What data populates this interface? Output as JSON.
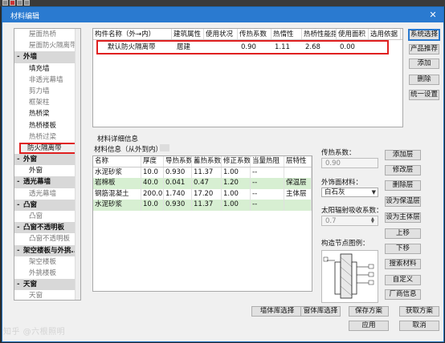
{
  "window": {
    "title": "材料编辑",
    "close_glyph": "✕"
  },
  "sidebar": {
    "items": [
      {
        "kind": "sub",
        "label": "屋面热桥"
      },
      {
        "kind": "sub",
        "label": "屋面防火隔离带"
      },
      {
        "kind": "cat",
        "toggle": "-",
        "label": "外墙"
      },
      {
        "kind": "sub-dark",
        "label": "填充墙"
      },
      {
        "kind": "sub",
        "label": "非透光幕墙"
      },
      {
        "kind": "sub",
        "label": "剪力墙"
      },
      {
        "kind": "sub",
        "label": "框架柱"
      },
      {
        "kind": "sub-dark",
        "label": "热桥梁"
      },
      {
        "kind": "sub-dark",
        "label": "热桥楼板"
      },
      {
        "kind": "sub",
        "label": "热桥过梁"
      },
      {
        "kind": "sub-sel",
        "label": "防火隔离带"
      },
      {
        "kind": "cat",
        "toggle": "-",
        "label": "外窗"
      },
      {
        "kind": "sub-dark",
        "label": "外窗"
      },
      {
        "kind": "cat",
        "toggle": "-",
        "label": "透光幕墙"
      },
      {
        "kind": "sub",
        "label": "透光幕墙"
      },
      {
        "kind": "cat",
        "toggle": "-",
        "label": "凸窗"
      },
      {
        "kind": "sub",
        "label": "凸窗"
      },
      {
        "kind": "cat",
        "toggle": "-",
        "label": "凸窗不透明板"
      },
      {
        "kind": "sub",
        "label": "凸窗不透明板"
      },
      {
        "kind": "cat",
        "toggle": "-",
        "label": "架空楼板与外挑..."
      },
      {
        "kind": "sub",
        "label": "架空楼板"
      },
      {
        "kind": "sub",
        "label": "外挑楼板"
      },
      {
        "kind": "cat",
        "toggle": "-",
        "label": "天窗"
      },
      {
        "kind": "sub",
        "label": "天窗"
      }
    ]
  },
  "top_grid": {
    "columns": [
      "构件名称（外→内）",
      "建筑属性",
      "使用状况",
      "传热系数",
      "热惰性",
      "热桥性能指...",
      "使用面积",
      "选用依据"
    ],
    "rows": [
      [
        "默认防火隔离带",
        "居建",
        "",
        "0.90",
        "1.11",
        "2.68",
        "0.00",
        ""
      ]
    ]
  },
  "right_buttons_top": [
    "系统选择",
    "产品推荐",
    "添加",
    "删除",
    "统一设置"
  ],
  "detail": {
    "section_title": "材料详细信息",
    "info_label": "材料信息（从外到内）",
    "columns": [
      "名称",
      "厚度",
      "导热系数",
      "蓄热系数",
      "修正系数",
      "当量热阻",
      "层特性"
    ],
    "rows": [
      {
        "highlight": false,
        "cells": [
          "水泥砂浆",
          "10.0",
          "0.930",
          "11.37",
          "1.00",
          "--",
          ""
        ]
      },
      {
        "highlight": true,
        "cells": [
          "岩棉板",
          "40.0",
          "0.041",
          "0.47",
          "1.20",
          "--",
          "保温层"
        ]
      },
      {
        "highlight": false,
        "cells": [
          "钢筋混凝土",
          "200.0",
          "1.740",
          "17.20",
          "1.00",
          "--",
          "主体层"
        ]
      },
      {
        "highlight": true,
        "cells": [
          "水泥砂浆",
          "10.0",
          "0.930",
          "11.37",
          "1.00",
          "--",
          ""
        ]
      }
    ]
  },
  "form": {
    "heat_transfer_label": "传热系数：",
    "heat_transfer_value": "0.90",
    "outer_material_label": "外饰面材料：",
    "outer_material_value": "白石灰",
    "solar_label": "太阳辐射吸收系数：",
    "solar_value": "0.7",
    "node_label": "构造节点图例："
  },
  "layer_buttons": [
    "添加层",
    "修改层",
    "删除层",
    "设为保温层",
    "设为主体层",
    "上移",
    "下移",
    "搜索材料",
    "自定义",
    "厂商信息"
  ],
  "bottom_buttons": {
    "wall_lib": "墙体库选择",
    "window_lib": "窗体库选择",
    "save_scheme": "保存方案",
    "load_scheme": "获取方案",
    "apply": "应用",
    "cancel": "取消"
  },
  "watermark": "知乎 @六根照明"
}
